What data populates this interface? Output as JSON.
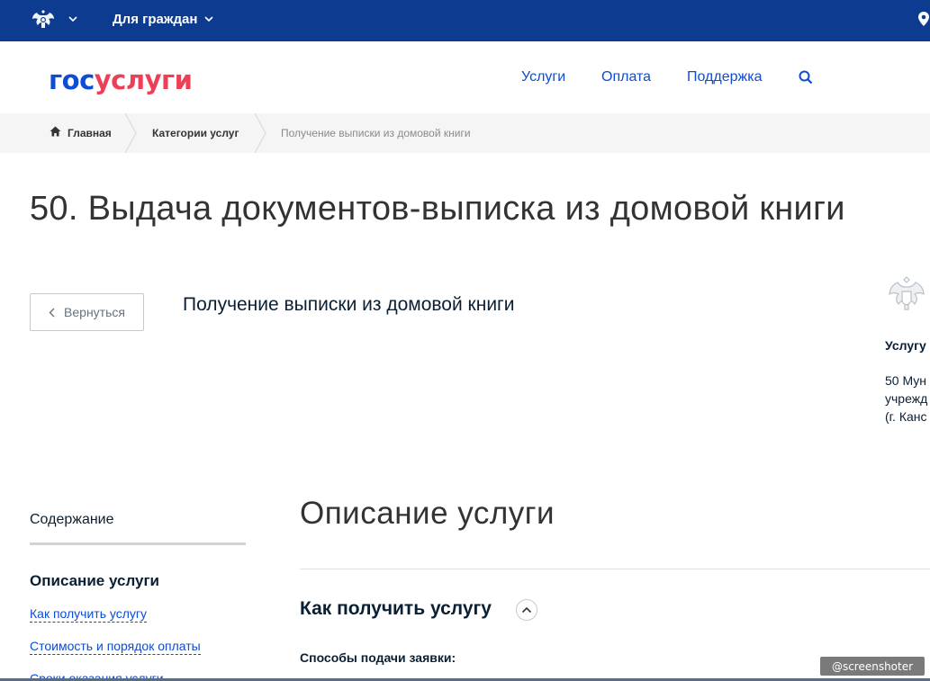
{
  "topbar": {
    "citizens_label": "Для граждан"
  },
  "header": {
    "logo_gos": "гос",
    "logo_uslugi": "услуги",
    "nav": [
      {
        "label": "Услуги"
      },
      {
        "label": "Оплата"
      },
      {
        "label": "Поддержка"
      }
    ]
  },
  "breadcrumb": {
    "home": "Главная",
    "categories": "Категории услуг",
    "current": "Получение выписки из домовой книги"
  },
  "page": {
    "title": "50. Выдача документов-выписка из домовой книги",
    "back_label": "Вернуться",
    "service_name": "Получение выписки из домовой книги"
  },
  "info": {
    "heading": "Услугу",
    "lines": [
      "50 Мун",
      "учрежд",
      "(г. Канс"
    ]
  },
  "toc": {
    "title": "Содержание",
    "active": "Описание услуги",
    "links": [
      "Как получить услугу",
      "Стоимость и порядок оплаты",
      "Сроки оказания услуги"
    ]
  },
  "content": {
    "section_title": "Описание услуги",
    "sub_title": "Как получить услугу",
    "methods_label": "Способы подачи заявки:"
  },
  "watermark": "@screenshoter",
  "colors": {
    "topbar": "#0d3b8f",
    "link": "#0d4cd3",
    "logo_red": "#ee3f58"
  }
}
